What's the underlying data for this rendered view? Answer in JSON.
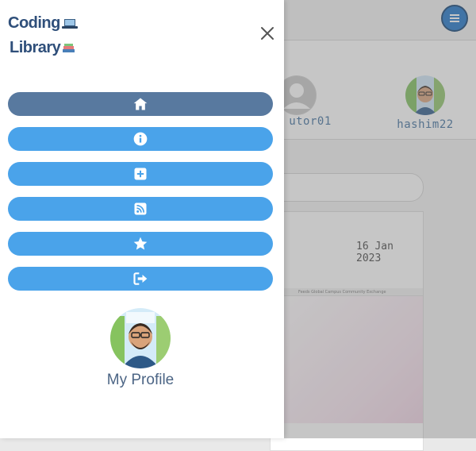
{
  "brand": {
    "line1": "Coding",
    "line2": "Library"
  },
  "drawer": {
    "nav_items": [
      {
        "icon": "home-icon",
        "active": true
      },
      {
        "icon": "info-icon",
        "active": false
      },
      {
        "icon": "add-icon",
        "active": false
      },
      {
        "icon": "rss-icon",
        "active": false
      },
      {
        "icon": "star-icon",
        "active": false
      },
      {
        "icon": "logout-icon",
        "active": false
      }
    ],
    "profile_label": "My Profile"
  },
  "background": {
    "users": [
      {
        "name": "utor01"
      },
      {
        "name": "hashim22"
      }
    ],
    "post": {
      "date": "16 Jan 2023",
      "screenshot_nav": "Feeds   Global Campus   Community Exchange"
    }
  },
  "colors": {
    "nav_button": "#4aa3ea",
    "nav_button_active": "#58799f",
    "brand_text": "#2f4f7a",
    "menu_toggle": "#1a73c9"
  }
}
